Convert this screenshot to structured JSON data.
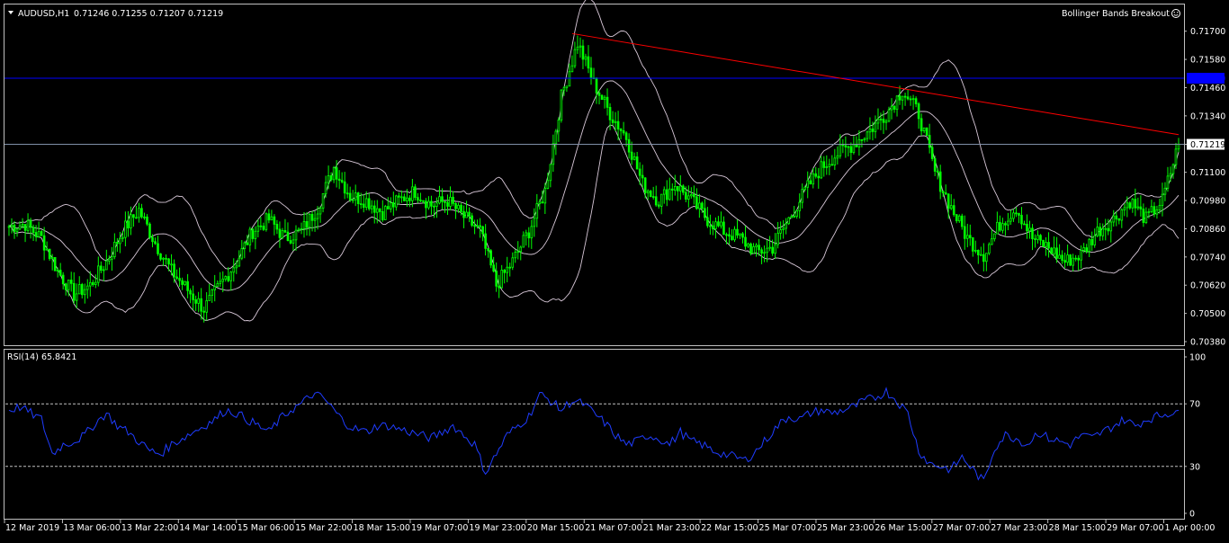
{
  "header": {
    "symbol_label": "AUDUSD,H1",
    "ohlc": "0.71246 0.71255 0.71207 0.71219",
    "expert_name": "Bollinger Bands Breakout",
    "expert_icon": "smiley-face-icon"
  },
  "rsi_header": {
    "label": "RSI(14) 65.8421"
  },
  "colors": {
    "background": "#000000",
    "candles": "#00ff00",
    "bands": "#d8c8d8",
    "trendline": "#ff0000",
    "hline": "#0000ff",
    "rsi_line": "#1f3cff",
    "axis_text": "#ffffff",
    "bid_line": "#7f8fa8",
    "hline_marker_bg": "#0000ff",
    "current_marker_bg": "#ffffff"
  },
  "chart_data": [
    {
      "type": "candlestick",
      "symbol": "AUDUSD",
      "timeframe": "H1",
      "ylim": [
        0.7038,
        0.7176
      ],
      "y_ticks": [
        "0.71700",
        "0.71580",
        "0.71460",
        "0.71340",
        "0.71219",
        "0.71100",
        "0.70980",
        "0.70860",
        "0.70740",
        "0.70620",
        "0.70500",
        "0.70380"
      ],
      "x_ticks": [
        "12 Mar 2019",
        "13 Mar 06:00",
        "13 Mar 22:00",
        "14 Mar 14:00",
        "15 Mar 06:00",
        "15 Mar 22:00",
        "18 Mar 15:00",
        "19 Mar 07:00",
        "19 Mar 23:00",
        "20 Mar 15:00",
        "21 Mar 07:00",
        "21 Mar 23:00",
        "22 Mar 15:00",
        "25 Mar 07:00",
        "25 Mar 23:00",
        "26 Mar 15:00",
        "27 Mar 07:00",
        "27 Mar 23:00",
        "28 Mar 15:00",
        "29 Mar 07:00",
        "1 Apr 00:00"
      ],
      "close_path": [
        [
          0,
          0.7087
        ],
        [
          6,
          0.7088
        ],
        [
          12,
          0.7082
        ],
        [
          18,
          0.7068
        ],
        [
          24,
          0.7058
        ],
        [
          30,
          0.7062
        ],
        [
          36,
          0.7072
        ],
        [
          42,
          0.7085
        ],
        [
          48,
          0.7094
        ],
        [
          54,
          0.708
        ],
        [
          60,
          0.7068
        ],
        [
          66,
          0.706
        ],
        [
          72,
          0.7052
        ],
        [
          78,
          0.7062
        ],
        [
          84,
          0.7072
        ],
        [
          90,
          0.7085
        ],
        [
          96,
          0.709
        ],
        [
          102,
          0.7082
        ],
        [
          108,
          0.7085
        ],
        [
          114,
          0.7095
        ],
        [
          120,
          0.7112
        ],
        [
          126,
          0.71
        ],
        [
          132,
          0.7098
        ],
        [
          138,
          0.7093
        ],
        [
          144,
          0.7098
        ],
        [
          150,
          0.7102
        ],
        [
          156,
          0.7096
        ],
        [
          162,
          0.7098
        ],
        [
          168,
          0.7091
        ],
        [
          174,
          0.7085
        ],
        [
          180,
          0.7062
        ],
        [
          186,
          0.7072
        ],
        [
          192,
          0.7085
        ],
        [
          198,
          0.7102
        ],
        [
          204,
          0.7142
        ],
        [
          210,
          0.7165
        ],
        [
          216,
          0.7148
        ],
        [
          222,
          0.7135
        ],
        [
          228,
          0.7125
        ],
        [
          234,
          0.7105
        ],
        [
          240,
          0.7098
        ],
        [
          246,
          0.7105
        ],
        [
          252,
          0.7098
        ],
        [
          258,
          0.709
        ],
        [
          264,
          0.7085
        ],
        [
          270,
          0.7082
        ],
        [
          276,
          0.7076
        ],
        [
          282,
          0.7078
        ],
        [
          288,
          0.709
        ],
        [
          294,
          0.7102
        ],
        [
          300,
          0.7112
        ],
        [
          306,
          0.7118
        ],
        [
          312,
          0.7122
        ],
        [
          318,
          0.7128
        ],
        [
          324,
          0.7135
        ],
        [
          330,
          0.7145
        ],
        [
          336,
          0.7135
        ],
        [
          342,
          0.711
        ],
        [
          348,
          0.7095
        ],
        [
          354,
          0.7082
        ],
        [
          360,
          0.7075
        ],
        [
          366,
          0.7088
        ],
        [
          372,
          0.7095
        ],
        [
          378,
          0.7082
        ],
        [
          384,
          0.7078
        ],
        [
          390,
          0.7072
        ],
        [
          396,
          0.7075
        ],
        [
          402,
          0.7085
        ],
        [
          408,
          0.709
        ],
        [
          414,
          0.7098
        ],
        [
          420,
          0.709
        ],
        [
          426,
          0.7098
        ],
        [
          432,
          0.7122
        ]
      ],
      "bands_period_bars": 20,
      "horizontal_line": 0.715,
      "current_price": 0.71219,
      "trendline": {
        "from": [
          208,
          0.7169
        ],
        "to": [
          432,
          0.7126
        ]
      }
    },
    {
      "type": "line",
      "name": "RSI(14)",
      "ylim": [
        0,
        100
      ],
      "y_ticks": [
        "100",
        "70",
        "30",
        "0"
      ],
      "levels": [
        70,
        30
      ],
      "value": 65.8421,
      "path": [
        [
          0,
          66
        ],
        [
          4,
          68
        ],
        [
          8,
          64
        ],
        [
          12,
          60
        ],
        [
          16,
          38
        ],
        [
          20,
          44
        ],
        [
          24,
          46
        ],
        [
          28,
          50
        ],
        [
          32,
          58
        ],
        [
          36,
          64
        ],
        [
          40,
          56
        ],
        [
          44,
          52
        ],
        [
          48,
          46
        ],
        [
          52,
          40
        ],
        [
          56,
          38
        ],
        [
          60,
          44
        ],
        [
          64,
          48
        ],
        [
          68,
          52
        ],
        [
          72,
          56
        ],
        [
          76,
          60
        ],
        [
          80,
          66
        ],
        [
          84,
          64
        ],
        [
          88,
          60
        ],
        [
          92,
          56
        ],
        [
          96,
          52
        ],
        [
          100,
          60
        ],
        [
          104,
          66
        ],
        [
          108,
          70
        ],
        [
          112,
          76
        ],
        [
          116,
          74
        ],
        [
          120,
          66
        ],
        [
          124,
          58
        ],
        [
          128,
          54
        ],
        [
          132,
          52
        ],
        [
          136,
          56
        ],
        [
          140,
          56
        ],
        [
          144,
          54
        ],
        [
          148,
          52
        ],
        [
          152,
          50
        ],
        [
          156,
          48
        ],
        [
          160,
          52
        ],
        [
          164,
          56
        ],
        [
          168,
          50
        ],
        [
          172,
          44
        ],
        [
          176,
          26
        ],
        [
          180,
          38
        ],
        [
          184,
          50
        ],
        [
          188,
          56
        ],
        [
          192,
          62
        ],
        [
          196,
          76
        ],
        [
          200,
          72
        ],
        [
          204,
          66
        ],
        [
          208,
          72
        ],
        [
          212,
          70
        ],
        [
          216,
          64
        ],
        [
          220,
          58
        ],
        [
          224,
          50
        ],
        [
          228,
          44
        ],
        [
          232,
          46
        ],
        [
          236,
          50
        ],
        [
          240,
          48
        ],
        [
          244,
          44
        ],
        [
          248,
          52
        ],
        [
          252,
          46
        ],
        [
          256,
          44
        ],
        [
          260,
          40
        ],
        [
          264,
          38
        ],
        [
          268,
          36
        ],
        [
          272,
          34
        ],
        [
          276,
          40
        ],
        [
          280,
          48
        ],
        [
          284,
          56
        ],
        [
          288,
          62
        ],
        [
          292,
          60
        ],
        [
          296,
          64
        ],
        [
          300,
          66
        ],
        [
          304,
          64
        ],
        [
          308,
          66
        ],
        [
          312,
          68
        ],
        [
          316,
          72
        ],
        [
          320,
          74
        ],
        [
          324,
          78
        ],
        [
          328,
          72
        ],
        [
          332,
          64
        ],
        [
          336,
          40
        ],
        [
          340,
          32
        ],
        [
          344,
          30
        ],
        [
          348,
          28
        ],
        [
          352,
          36
        ],
        [
          356,
          28
        ],
        [
          360,
          20
        ],
        [
          364,
          42
        ],
        [
          368,
          50
        ],
        [
          372,
          48
        ],
        [
          376,
          44
        ],
        [
          380,
          52
        ],
        [
          384,
          48
        ],
        [
          388,
          46
        ],
        [
          392,
          44
        ],
        [
          396,
          50
        ],
        [
          400,
          48
        ],
        [
          404,
          52
        ],
        [
          408,
          56
        ],
        [
          412,
          60
        ],
        [
          416,
          56
        ],
        [
          420,
          60
        ],
        [
          424,
          62
        ],
        [
          428,
          64
        ],
        [
          432,
          66
        ]
      ]
    }
  ]
}
